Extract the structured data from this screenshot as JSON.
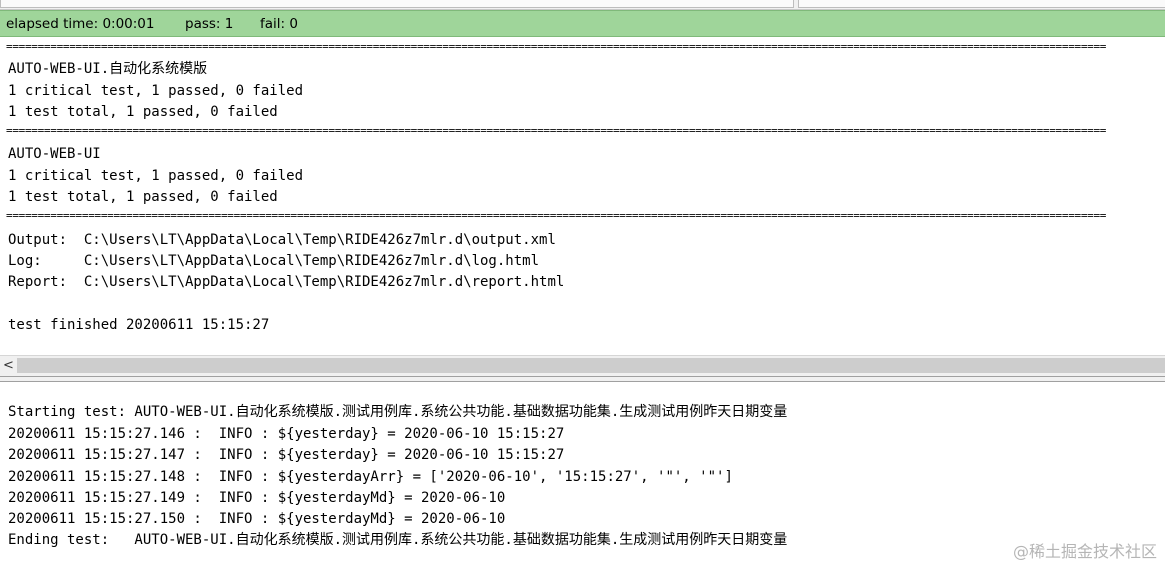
{
  "status": {
    "elapsed": "elapsed time: 0:00:01",
    "pass": "pass: 1",
    "fail": "fail: 0",
    "color": "#9fd59a"
  },
  "output": {
    "separator": "==============================================================================================================================================================================",
    "suite1_name": "AUTO-WEB-UI.自动化系统模版",
    "suite1_critical": "1 critical test, 1 passed, 0 failed",
    "suite1_total": "1 test total, 1 passed, 0 failed",
    "suite2_name": "AUTO-WEB-UI",
    "suite2_critical": "1 critical test, 1 passed, 0 failed",
    "suite2_total": "1 test total, 1 passed, 0 failed",
    "output_file": "Output:  C:\\Users\\LT\\AppData\\Local\\Temp\\RIDE426z7mlr.d\\output.xml",
    "log_file": "Log:     C:\\Users\\LT\\AppData\\Local\\Temp\\RIDE426z7mlr.d\\log.html",
    "report_file": "Report:  C:\\Users\\LT\\AppData\\Local\\Temp\\RIDE426z7mlr.d\\report.html",
    "finished": "test finished 20200611 15:15:27"
  },
  "scroll": {
    "left_arrow": "<"
  },
  "messages": {
    "lines": [
      "Starting test: AUTO-WEB-UI.自动化系统模版.测试用例库.系统公共功能.基础数据功能集.生成测试用例昨天日期变量",
      "20200611 15:15:27.146 :  INFO : ${yesterday} = 2020-06-10 15:15:27",
      "20200611 15:15:27.147 :  INFO : ${yesterday} = 2020-06-10 15:15:27",
      "20200611 15:15:27.148 :  INFO : ${yesterdayArr} = ['2020-06-10', '15:15:27', '\"', '\"']",
      "20200611 15:15:27.149 :  INFO : ${yesterdayMd} = 2020-06-10",
      "20200611 15:15:27.150 :  INFO : ${yesterdayMd} = 2020-06-10",
      "Ending test:   AUTO-WEB-UI.自动化系统模版.测试用例库.系统公共功能.基础数据功能集.生成测试用例昨天日期变量"
    ]
  },
  "watermark": "@稀土掘金技术社区"
}
